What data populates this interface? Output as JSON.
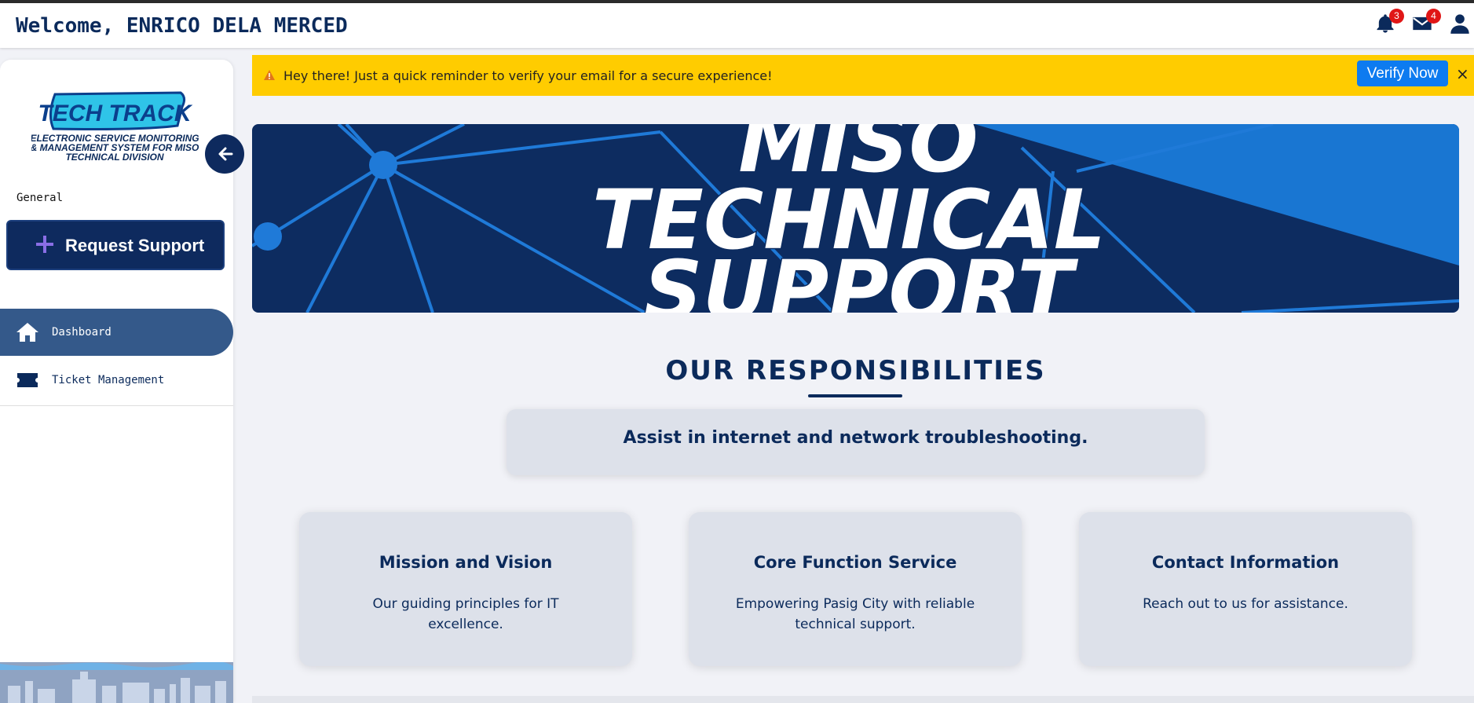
{
  "header": {
    "welcome": "Welcome, ENRICO DELA MERCED",
    "notifications_count": "3",
    "messages_count": "4",
    "icons": [
      "bell-icon",
      "envelope-icon",
      "user-icon"
    ]
  },
  "sidebar": {
    "logo_title": "TECH TRACK",
    "logo_subtitle": [
      "ELECTRONIC SERVICE MONITORING",
      "& MANAGEMENT SYSTEM FOR MISO",
      "TECHNICAL DIVISION"
    ],
    "section_label": "General",
    "request_button": "Request Support",
    "items": [
      {
        "label": "Dashboard",
        "icon": "home-icon",
        "active": true
      },
      {
        "label": "Ticket Management",
        "icon": "ticket-icon",
        "active": false
      }
    ]
  },
  "alert": {
    "message": "Hey there! Just a quick reminder to verify your email for a secure experience!",
    "button": "Verify Now",
    "close": "×"
  },
  "banner": {
    "lines": [
      "MISO",
      "TECHNICAL",
      "SUPPORT"
    ]
  },
  "main": {
    "section_title": "OUR RESPONSIBILITIES",
    "responsibility": "Assist in internet and network troubleshooting.",
    "cards": [
      {
        "title": "Mission and Vision",
        "desc": "Our guiding principles for IT excellence."
      },
      {
        "title": "Core Function Service",
        "desc": "Empowering Pasig City with reliable technical support."
      },
      {
        "title": "Contact Information",
        "desc": "Reach out to us for assistance."
      }
    ]
  },
  "colors": {
    "navy": "#0b2a5b",
    "alert_yellow": "#ffcc00",
    "verify_blue": "#0d7bf0",
    "active_nav": "#34598a",
    "badge_red": "#e01616"
  }
}
